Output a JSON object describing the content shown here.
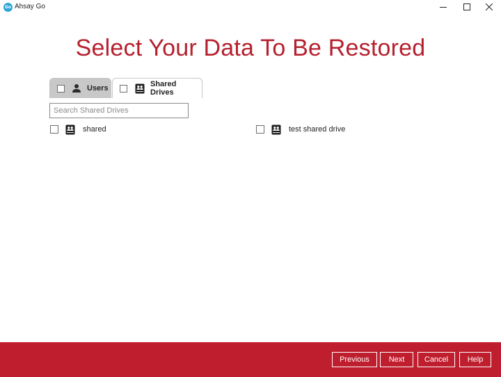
{
  "window": {
    "app_icon_text": "Go",
    "title": "Ahsay Go"
  },
  "page": {
    "heading": "Select Your Data To Be Restored"
  },
  "tabs": [
    {
      "label": "Users",
      "icon": "user-icon",
      "selected": false,
      "checked": false
    },
    {
      "label": "Shared Drives",
      "icon": "shared-drive-icon",
      "selected": true,
      "checked": false
    }
  ],
  "search": {
    "placeholder": "Search Shared Drives",
    "value": ""
  },
  "shared_drives": [
    {
      "name": "shared",
      "icon": "shared-drive-icon",
      "checked": false
    },
    {
      "name": "test shared drive",
      "icon": "shared-drive-icon",
      "checked": false
    }
  ],
  "footer": {
    "previous_label": "Previous",
    "next_label": "Next",
    "cancel_label": "Cancel",
    "help_label": "Help"
  },
  "colors": {
    "accent": "#b5202e",
    "footer_bg": "#bf1e2e",
    "inactive_tab_bg": "#c8c8c8"
  }
}
